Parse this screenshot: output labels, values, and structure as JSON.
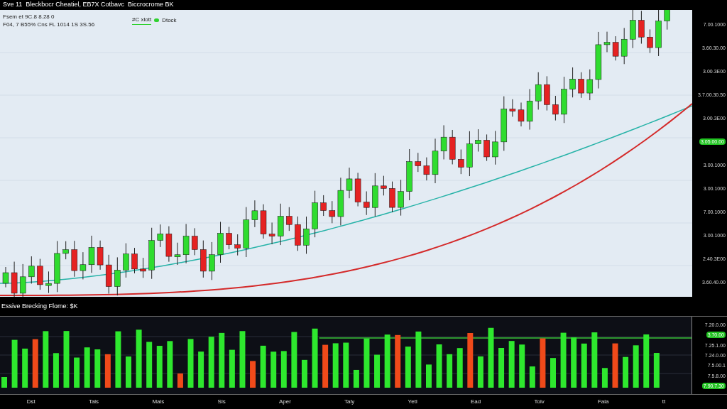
{
  "title_bar": {
    "title": "Sve 11  Bleckbocr Cheatiel, EB7X Cotbavc  Biccrocrome BK"
  },
  "price_chart": {
    "info_lines": [
      "Fsem et 9C.8 8.28 0",
      "F04, 7 B55% Cns FL 1014 1S 3S.56"
    ],
    "legend": [
      {
        "label": "#C xlott",
        "color": "#2fd12f",
        "kind": "text"
      },
      {
        "label": "Dtock",
        "color": "#2fd12f",
        "kind": "dot"
      }
    ],
    "axis_labels": [
      {
        "label": "7.00.1000",
        "highlighted": false
      },
      {
        "label": "3.60.30.00",
        "highlighted": false
      },
      {
        "label": "3.00.3E00",
        "highlighted": false
      },
      {
        "label": "3.7.00.30.50",
        "highlighted": false
      },
      {
        "label": "3.00.3E00",
        "highlighted": false
      },
      {
        "label": "3.05.00.00",
        "highlighted": true
      },
      {
        "label": "3.00.1000",
        "highlighted": false
      },
      {
        "label": "3.00.1000",
        "highlighted": false
      },
      {
        "label": "7.00.1000",
        "highlighted": false
      },
      {
        "label": "3.00.1000",
        "highlighted": false
      },
      {
        "label": "2.40.3E00",
        "highlighted": false
      },
      {
        "label": "3.60.40.00",
        "highlighted": false
      }
    ]
  },
  "volume_chart": {
    "title": "Essive Brecking Flome: $K",
    "axis_labels": [
      {
        "label": "7.20.0.00",
        "highlighted": false
      },
      {
        "label": "3.70.00",
        "highlighted": true
      },
      {
        "label": "7.25.1.00",
        "highlighted": false
      },
      {
        "label": "7.24.0.00",
        "highlighted": false
      },
      {
        "label": "7.5.00.1",
        "highlighted": false
      },
      {
        "label": "7.5.8.00",
        "highlighted": false
      },
      {
        "label": "7.90.7.30",
        "highlighted": true
      }
    ],
    "x_labels": [
      "Dst",
      "Tals",
      "Mals",
      "Sls",
      "Aper",
      "Taly",
      "Yetl",
      "Ead",
      "Tolv",
      "Fala",
      "tt"
    ]
  }
}
